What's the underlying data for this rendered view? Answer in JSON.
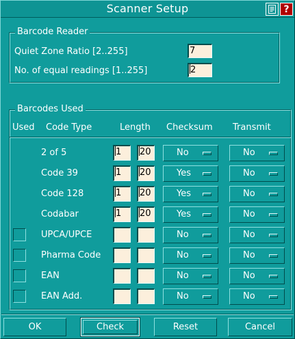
{
  "window": {
    "title": "Scanner Setup",
    "help_label": "?"
  },
  "reader": {
    "legend": "Barcode Reader",
    "quiet_zone_label": "Quiet Zone Ratio [2..255]",
    "quiet_zone_value": "7",
    "equal_readings_label": "No. of equal readings [1..255]",
    "equal_readings_value": "2"
  },
  "barcodes": {
    "legend": "Barcodes Used",
    "headers": {
      "used": "Used",
      "code_type": "Code Type",
      "length": "Length",
      "checksum": "Checksum",
      "transmit": "Transmit"
    },
    "rows": [
      {
        "name": "2 of 5",
        "len_min": "1",
        "len_max": "20",
        "checksum": "No",
        "transmit": "No",
        "has_checkbox": false
      },
      {
        "name": "Code 39",
        "len_min": "1",
        "len_max": "20",
        "checksum": "Yes",
        "transmit": "No",
        "has_checkbox": false
      },
      {
        "name": "Code 128",
        "len_min": "1",
        "len_max": "20",
        "checksum": "Yes",
        "transmit": "No",
        "has_checkbox": false
      },
      {
        "name": "Codabar",
        "len_min": "1",
        "len_max": "20",
        "checksum": "Yes",
        "transmit": "No",
        "has_checkbox": false
      },
      {
        "name": "UPCA/UPCE",
        "len_min": "",
        "len_max": "",
        "checksum": "No",
        "transmit": "No",
        "has_checkbox": true
      },
      {
        "name": "Pharma Code",
        "len_min": "",
        "len_max": "",
        "checksum": "No",
        "transmit": "No",
        "has_checkbox": true
      },
      {
        "name": "EAN",
        "len_min": "",
        "len_max": "",
        "checksum": "No",
        "transmit": "No",
        "has_checkbox": true
      },
      {
        "name": "EAN Add.",
        "len_min": "",
        "len_max": "",
        "checksum": "No",
        "transmit": "No",
        "has_checkbox": true
      }
    ]
  },
  "buttons": {
    "ok": "OK",
    "check": "Check",
    "reset": "Reset",
    "cancel": "Cancel"
  },
  "colors": {
    "background": "#109c9c",
    "field": "#fcefdc",
    "help_button": "#b00000",
    "text": "#ffffff"
  }
}
